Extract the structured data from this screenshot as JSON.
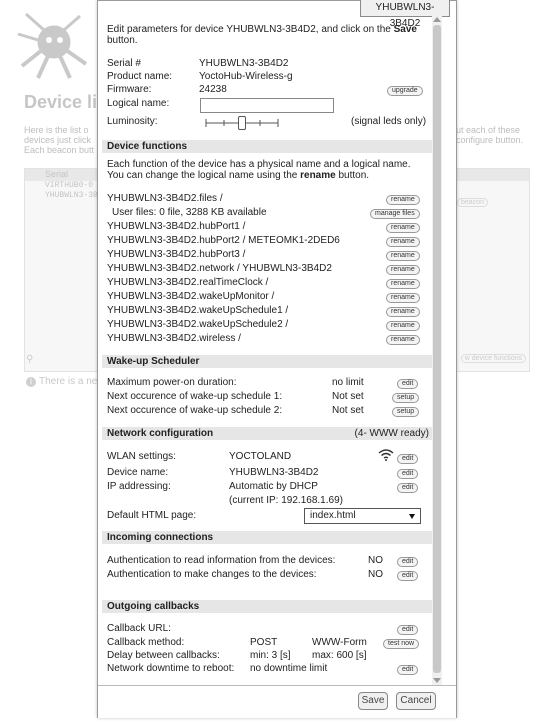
{
  "background": {
    "title": "Device li",
    "desc_left": "Here is the list o devices just click Each beacon butt",
    "desc_right": "ut each of these configure button.",
    "table_header": "Serial",
    "rows": [
      "VIRTHUB0-0",
      "YHUBWLN3-3B"
    ],
    "beacon_label": "beacon",
    "view_functions": "w device functions",
    "note": "There is a new"
  },
  "dialog": {
    "tab_label": "YHUBWLN3-3B4D2",
    "intro_prefix": "Edit parameters for device YHUBWLN3-3B4D2, and click on the ",
    "intro_bold": "Save",
    "intro_suffix": " button.",
    "serial_label": "Serial #",
    "serial_value": "YHUBWLN3-3B4D2",
    "product_label": "Product name:",
    "product_value": "YoctoHub-Wireless-g",
    "firmware_label": "Firmware:",
    "firmware_value": "24238",
    "upgrade_btn": "upgrade",
    "logical_label": "Logical name:",
    "logical_value": "",
    "luminosity_label": "Luminosity:",
    "luminosity_level": 0.5,
    "luminosity_note": "(signal leds only)",
    "functions_header": "Device functions",
    "functions_desc_prefix": "Each function of the device has a physical name and a logical name. You can change the logical name using the ",
    "functions_desc_bold": "rename",
    "functions_desc_suffix": " button.",
    "files_label": "YHUBWLN3-3B4D2.files /",
    "userfiles_label": "User files: 0 file, 3288 KB available",
    "manage_files_btn": "manage files",
    "rename_btn": "rename",
    "functions": [
      "YHUBWLN3-3B4D2.hubPort1 /",
      "YHUBWLN3-3B4D2.hubPort2 / METEOMK1-2DED6",
      "YHUBWLN3-3B4D2.hubPort3 /",
      "YHUBWLN3-3B4D2.network / YHUBWLN3-3B4D2",
      "YHUBWLN3-3B4D2.realTimeClock /",
      "YHUBWLN3-3B4D2.wakeUpMonitor /",
      "YHUBWLN3-3B4D2.wakeUpSchedule1 /",
      "YHUBWLN3-3B4D2.wakeUpSchedule2 /",
      "YHUBWLN3-3B4D2.wireless /"
    ],
    "wakeup_header": "Wake-up Scheduler",
    "max_power_label": "Maximum power-on duration:",
    "max_power_value": "no limit",
    "edit_btn": "edit",
    "setup_btn": "setup",
    "next1_label": "Next occurence of wake-up schedule 1:",
    "next1_value": "Not set",
    "next2_label": "Next occurence of wake-up schedule 2:",
    "next2_value": "Not set",
    "network_header": "Network configuration",
    "network_status": "(4- WWW ready)",
    "wlan_label": "WLAN settings:",
    "wlan_value": "YOCTOLAND",
    "devname_label": "Device name:",
    "devname_value": "YHUBWLN3-3B4D2",
    "ip_label": "IP addressing:",
    "ip_value": "Automatic by DHCP",
    "ip_current": "(current IP: 192.168.1.69)",
    "html_label": "Default HTML page:",
    "html_value": "index.html",
    "incoming_header": "Incoming connections",
    "auth_read_label": "Authentication to read information from the devices:",
    "auth_read_value": "NO",
    "auth_write_label": "Authentication to make changes to the devices:",
    "auth_write_value": "NO",
    "outgoing_header": "Outgoing callbacks",
    "cb_url_label": "Callback URL:",
    "cb_method_label": "Callback method:",
    "cb_method_value": "POST",
    "cb_method_format": "WWW-Form",
    "test_now_btn": "test now",
    "cb_delay_label": "Delay between callbacks:",
    "cb_delay_min": "min: 3 [s]",
    "cb_delay_max": "max: 600 [s]",
    "downtime_label": "Network downtime to reboot:",
    "downtime_value": "no downtime limit",
    "save_btn": "Save",
    "cancel_btn": "Cancel"
  },
  "colors": {
    "section_bg": "#e6e6e6",
    "dialog_border": "#9a9a9a"
  },
  "icons": {
    "wifi": "wifi-icon",
    "logo": "octopus-logo"
  }
}
